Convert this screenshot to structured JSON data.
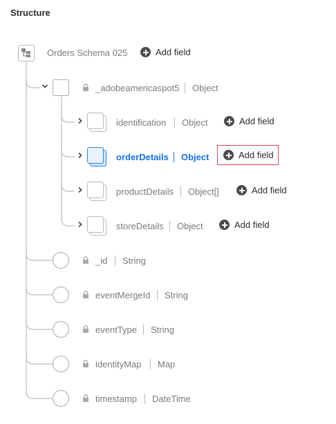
{
  "panel": {
    "title": "Structure"
  },
  "root": {
    "name": "Orders Schema 025",
    "add_label": "Add field"
  },
  "tenant": {
    "name": "_adobeamericaspot5",
    "type": "Object"
  },
  "children": [
    {
      "name": "identification",
      "type": "Object",
      "add_label": "Add field"
    },
    {
      "name": "orderDetails",
      "type": "Object",
      "add_label": "Add field"
    },
    {
      "name": "productDetails",
      "type": "Object[]",
      "add_label": "Add field"
    },
    {
      "name": "storeDetails",
      "type": "Object",
      "add_label": "Add field"
    }
  ],
  "fields": [
    {
      "name": "_id",
      "type": "String"
    },
    {
      "name": "eventMergeId",
      "type": "String"
    },
    {
      "name": "eventType",
      "type": "String"
    },
    {
      "name": "identityMap",
      "type": "Map"
    },
    {
      "name": "timestamp",
      "type": "DateTime"
    }
  ],
  "colors": {
    "accent": "#1473e6",
    "highlight_border": "#e34850"
  }
}
